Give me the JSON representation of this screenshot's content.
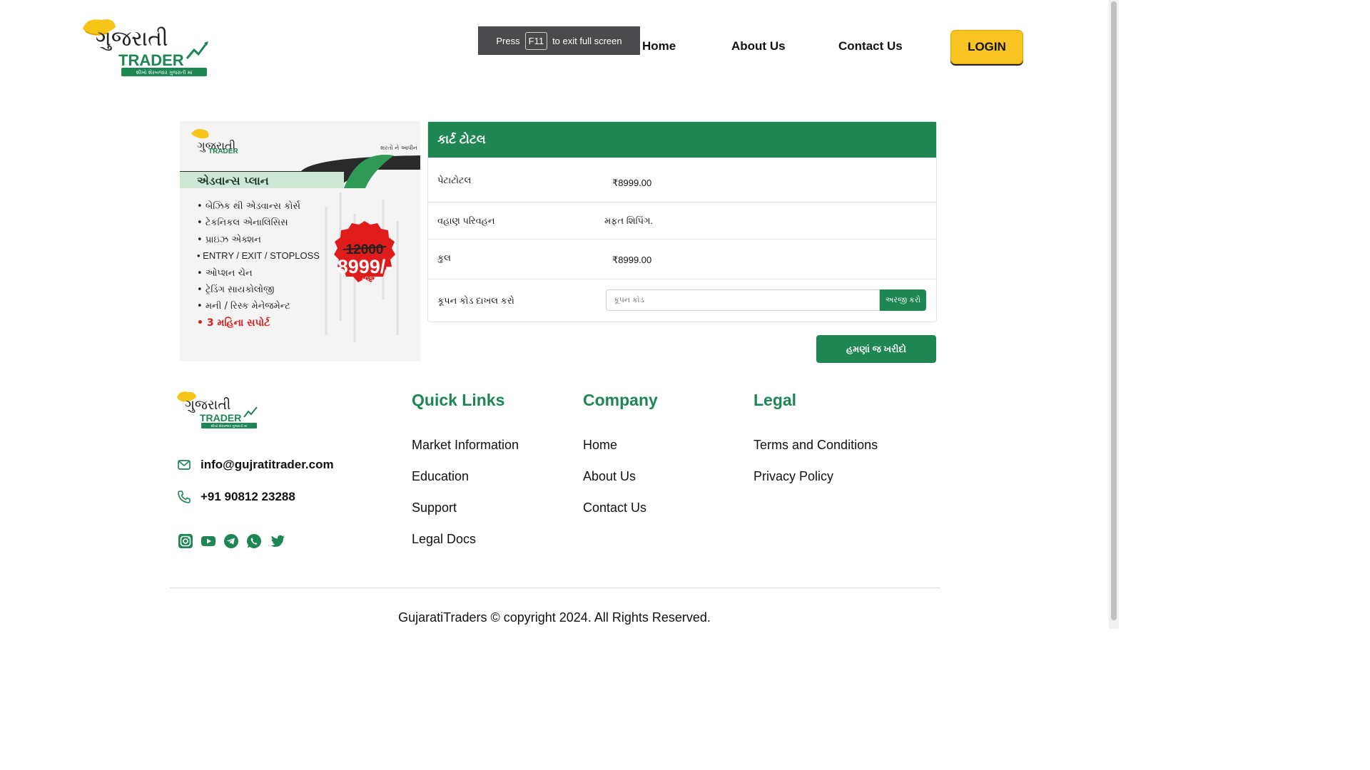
{
  "brand": {
    "logo_name": "ગુજરાતી",
    "logo_sub": "TRADER",
    "logo_tagline": "શીખો શેરબજાર ગુજરાતી માં"
  },
  "fullscreen_notice": {
    "press": "Press",
    "key": "F11",
    "rest": "to exit full screen"
  },
  "nav": {
    "home": "Home",
    "about": "About Us",
    "contact": "Contact Us",
    "login": "LOGIN"
  },
  "product": {
    "corner_text": "શરતો ને આધીન",
    "plan_title": "એડવાન્સ પ્લાન",
    "features": [
      "બેઝિક થી એડવાન્સ કોર્સ",
      "ટેકનિકલ એનાલિસિસ",
      "પ્રાઇઝ એક્શન",
      "ENTRY / EXIT / STOPLOSS",
      "ઓપ્શન ચેન",
      "ટ્રેડિંગ સાયકોલોજી",
      "મની / રિસ્ક મેનેજમેન્ટ"
    ],
    "support": "3 મહિના સપોર્ટ",
    "old_price": "12000",
    "new_price": "8999/-",
    "gst": "+GST"
  },
  "cart": {
    "title": "કાર્ટ ટોટલ",
    "subtotal_label": "પેટાટોટલ",
    "subtotal_value": "₹8999.00",
    "shipping_label": "વહાણ પરિવહન",
    "shipping_value": "મફત શિપિંગ.",
    "total_label": "કુલ",
    "total_value": "₹8999.00",
    "coupon_label": "કૂપન કોડ દાખલ કરો",
    "coupon_placeholder": "કૂપન કોડ",
    "apply_label": "અરજી કરો",
    "buy_label": "હમણાં જ ખરીદો"
  },
  "footer": {
    "email": "info@gujratitrader.com",
    "phone": "+91 90812 23288",
    "social": [
      "instagram-icon",
      "youtube-icon",
      "telegram-icon",
      "whatsapp-icon",
      "twitter-icon"
    ],
    "quick_links": {
      "title": "Quick Links",
      "items": [
        "Market Information",
        "Education",
        "Support",
        "Legal Docs"
      ]
    },
    "company": {
      "title": "Company",
      "items": [
        "Home",
        "About Us",
        "Contact Us"
      ]
    },
    "legal": {
      "title": "Legal",
      "items": [
        "Terms and Conditions",
        "Privacy Policy"
      ]
    },
    "copyright": "GujaratiTraders © copyright 2024. All Rights Reserved."
  },
  "colors": {
    "brand_green": "#1e8652",
    "login_yellow": "#f9c323",
    "badge_red": "#e01b1b",
    "turban_yellow": "#f5c518"
  }
}
